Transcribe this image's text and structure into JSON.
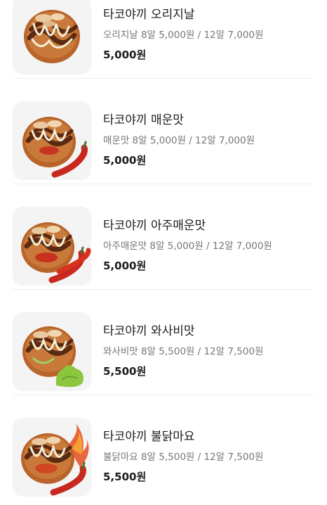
{
  "menu": {
    "items": [
      {
        "name": "타코야끼 오리지날",
        "description": "오리지날 8알 5,000원 / 12알 7,000원",
        "price": "5,000원",
        "image_icon": "takoyaki-original-icon"
      },
      {
        "name": "타코야끼 매운맛",
        "description": "매운맛 8알 5,000원 / 12알 7,000원",
        "price": "5,000원",
        "image_icon": "takoyaki-spicy-icon"
      },
      {
        "name": "타코야끼 아주매운맛",
        "description": "아주매운맛 8알 5,000원 / 12알 7,000원",
        "price": "5,000원",
        "image_icon": "takoyaki-extra-spicy-icon"
      },
      {
        "name": "타코야끼 와사비맛",
        "description": "와사비맛 8알 5,500원 / 12알 7,500원",
        "price": "5,500원",
        "image_icon": "takoyaki-wasabi-icon"
      },
      {
        "name": "타코야끼 불닭마요",
        "description": "불닭마요 8알 5,500원 / 12알 7,500원",
        "price": "5,500원",
        "image_icon": "takoyaki-buldak-mayo-icon"
      }
    ]
  },
  "colors": {
    "thumb_background": "#f4f4f4",
    "title_text": "#1c1c1c",
    "description_text": "#777777",
    "divider": "#eeeeee",
    "takoyaki_brown": "#b8642a",
    "sauce": "#5a2a12",
    "mayo": "#f6efd8",
    "chili_red": "#c8281e",
    "wasabi_green": "#8cc63e"
  }
}
